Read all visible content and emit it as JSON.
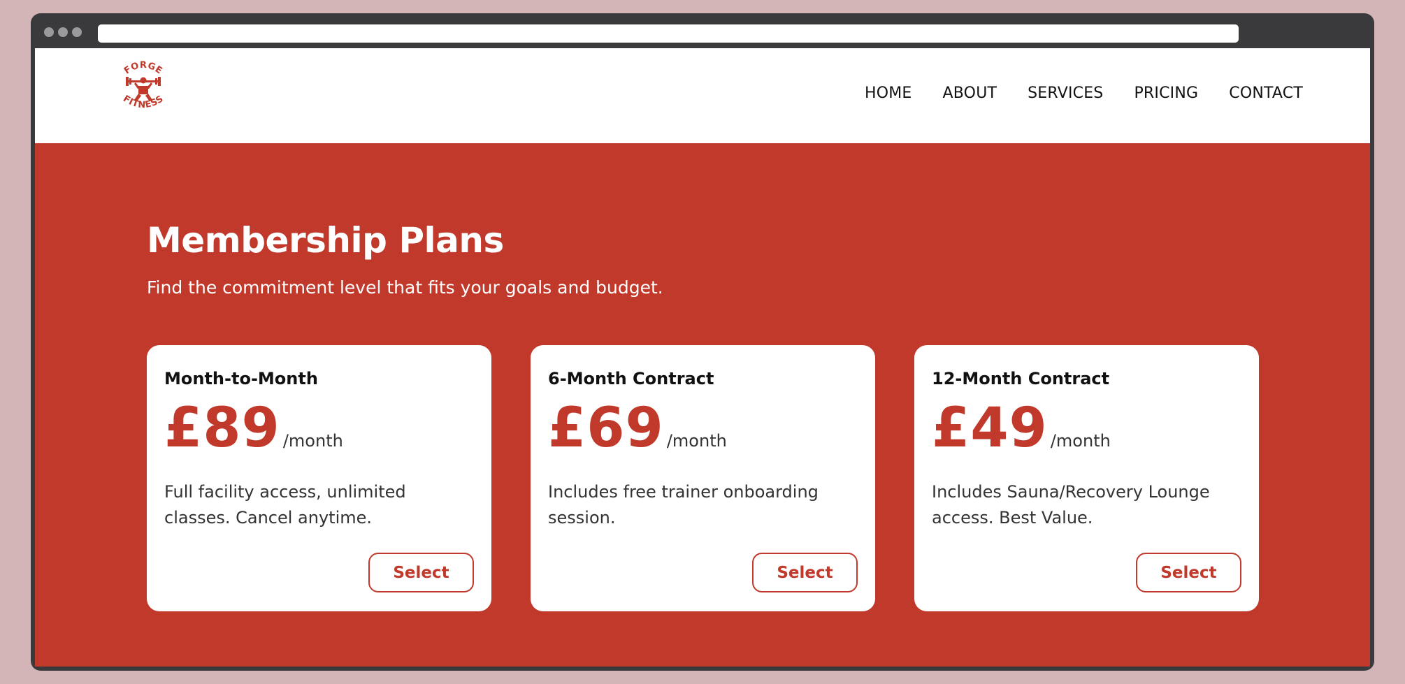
{
  "brand": {
    "logo_line1": "FORGE",
    "logo_line2": "FITNESS",
    "color": "#c0392b"
  },
  "nav": {
    "items": [
      {
        "label": "HOME"
      },
      {
        "label": "ABOUT"
      },
      {
        "label": "SERVICES"
      },
      {
        "label": "PRICING"
      },
      {
        "label": "CONTACT"
      }
    ]
  },
  "pricing": {
    "title": "Membership Plans",
    "subtitle": "Find the commitment level that fits your goals and budget.",
    "plans": [
      {
        "name": "Month-to-Month",
        "price": "£89",
        "period": "/month",
        "description": "Full facility access, unlimited classes. Cancel anytime.",
        "button": "Select"
      },
      {
        "name": "6-Month Contract",
        "price": "£69",
        "period": "/month",
        "description": "Includes free trainer onboarding session.",
        "button": "Select"
      },
      {
        "name": "12-Month Contract",
        "price": "£49",
        "period": "/month",
        "description": "Includes Sauna/Recovery Lounge access. Best Value.",
        "button": "Select"
      }
    ]
  },
  "colors": {
    "accent": "#c0392b",
    "page_background": "#d3b5b7",
    "browser_frame": "#3a3a3c"
  }
}
